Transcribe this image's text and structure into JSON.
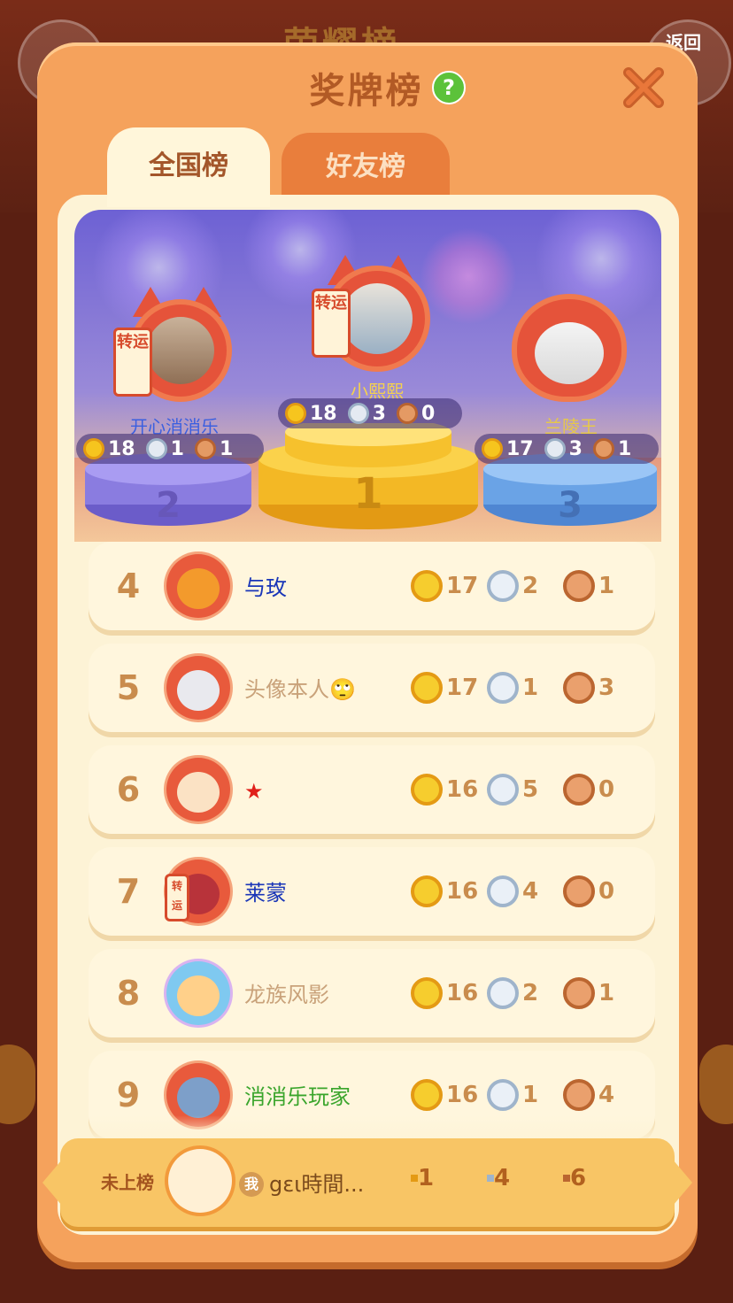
{
  "background": {
    "title": "荣耀榜",
    "back_label": "返回"
  },
  "header": {
    "title": "奖牌榜",
    "help_icon": "?",
    "close_icon": "close-icon"
  },
  "tabs": [
    {
      "label": "全国榜",
      "active": true
    },
    {
      "label": "好友榜",
      "active": false
    }
  ],
  "podium": {
    "first": {
      "rank": "1",
      "name": "小熙熙",
      "gold": "18",
      "silver": "3",
      "bronze": "0",
      "talisman": "转运"
    },
    "second": {
      "rank": "2",
      "name": "开心消消乐",
      "gold": "18",
      "silver": "1",
      "bronze": "1",
      "talisman": "转运"
    },
    "third": {
      "rank": "3",
      "name": "兰陵王",
      "gold": "17",
      "silver": "3",
      "bronze": "1"
    }
  },
  "rows": [
    {
      "rank": "4",
      "name": "与玫",
      "name_color": "#1a36b8",
      "gold": "17",
      "silver": "2",
      "bronze": "1"
    },
    {
      "rank": "5",
      "name": "头像本人🙄",
      "name_color": "#c9a27a",
      "gold": "17",
      "silver": "1",
      "bronze": "3"
    },
    {
      "rank": "6",
      "name": "★",
      "name_color": "#e0201a",
      "gold": "16",
      "silver": "5",
      "bronze": "0"
    },
    {
      "rank": "7",
      "name": "莱蒙",
      "name_color": "#1a36b8",
      "gold": "16",
      "silver": "4",
      "bronze": "0",
      "talisman": "转运"
    },
    {
      "rank": "8",
      "name": "龙族风影",
      "name_color": "#c9a27a",
      "gold": "16",
      "silver": "2",
      "bronze": "1"
    },
    {
      "rank": "9",
      "name": "消消乐玩家",
      "name_color": "#3aa52c",
      "gold": "16",
      "silver": "1",
      "bronze": "4"
    }
  ],
  "my_rank": {
    "rank_label": "未上榜",
    "me_badge": "我",
    "name": "gɛι時間...",
    "gold": "1",
    "silver": "4",
    "bronze": "6"
  },
  "colors": {
    "panel": "#f5a25c",
    "content": "#fdf3d6",
    "gold": "#f6c51e",
    "silver": "#e4eaf2",
    "bronze": "#e49a64"
  }
}
